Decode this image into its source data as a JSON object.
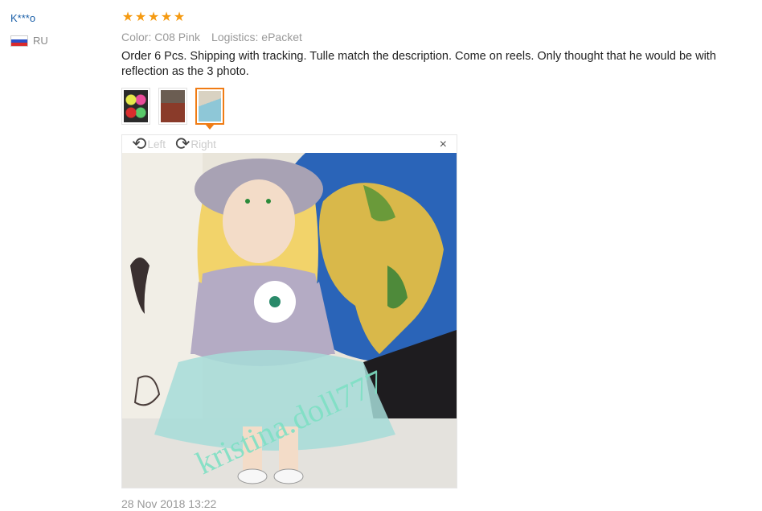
{
  "reviewer": {
    "name": "K***o",
    "country_code": "RU"
  },
  "rating": {
    "stars": 5,
    "max": 5
  },
  "attributes": [
    {
      "label": "Color: C08 Pink"
    },
    {
      "label": "Logistics: ePacket"
    }
  ],
  "review_text": "Order 6 Pcs. Shipping with tracking. Tulle match the description. Come on reels. Only thought that he would be with reflection as the 3 photo.",
  "thumbnails": [
    {
      "name": "photo-1"
    },
    {
      "name": "photo-2"
    },
    {
      "name": "photo-3",
      "active": true
    }
  ],
  "viewer": {
    "rotate_left_label": "Left",
    "rotate_right_label": "Right",
    "close_label": "×",
    "watermark": "kristina.doll777"
  },
  "date": "28 Nov 2018 13:22",
  "colors": {
    "accent": "#f07c14",
    "star": "#f59a11",
    "link": "#1a5fa8"
  }
}
